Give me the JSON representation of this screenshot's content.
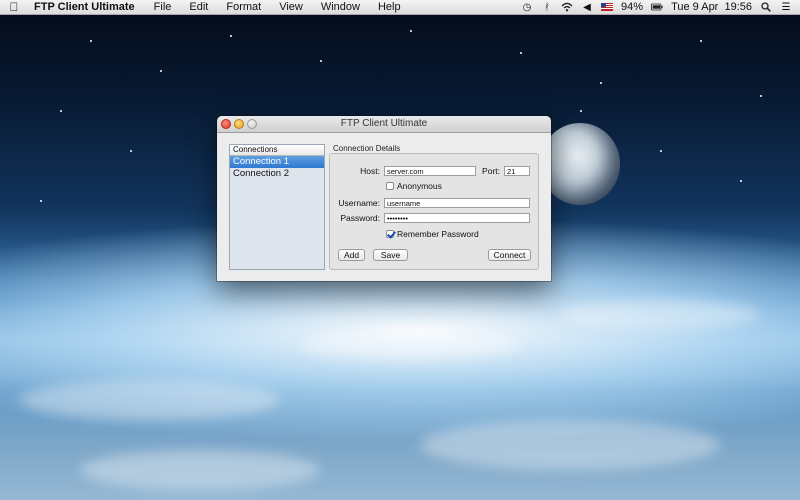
{
  "menubar": {
    "app_name": "FTP Client Ultimate",
    "items": [
      "File",
      "Edit",
      "Format",
      "View",
      "Window",
      "Help"
    ],
    "status": {
      "battery": "94%",
      "datetime": "Tue 9 Apr  19:56",
      "icons": [
        "time-machine-icon",
        "bluetooth-icon",
        "wifi-icon",
        "volume-icon",
        "flag-icon",
        "battery-icon",
        "spotlight-icon",
        "notification-center-icon"
      ]
    }
  },
  "window": {
    "title": "FTP Client Ultimate",
    "connections": {
      "header": "Connections",
      "items": [
        "Connection 1",
        "Connection 2"
      ],
      "selected_index": 0
    },
    "details": {
      "group_label": "Connection Details",
      "host_label": "Host:",
      "host_value": "server.com",
      "port_label": "Port:",
      "port_value": "21",
      "anonymous_label": "Anonymous",
      "anonymous_checked": false,
      "username_label": "Username:",
      "username_value": "username",
      "password_label": "Password:",
      "password_value": "••••••••",
      "remember_label": "Remember Password",
      "remember_checked": true,
      "add_button": "Add",
      "save_button": "Save",
      "connect_button": "Connect"
    }
  }
}
